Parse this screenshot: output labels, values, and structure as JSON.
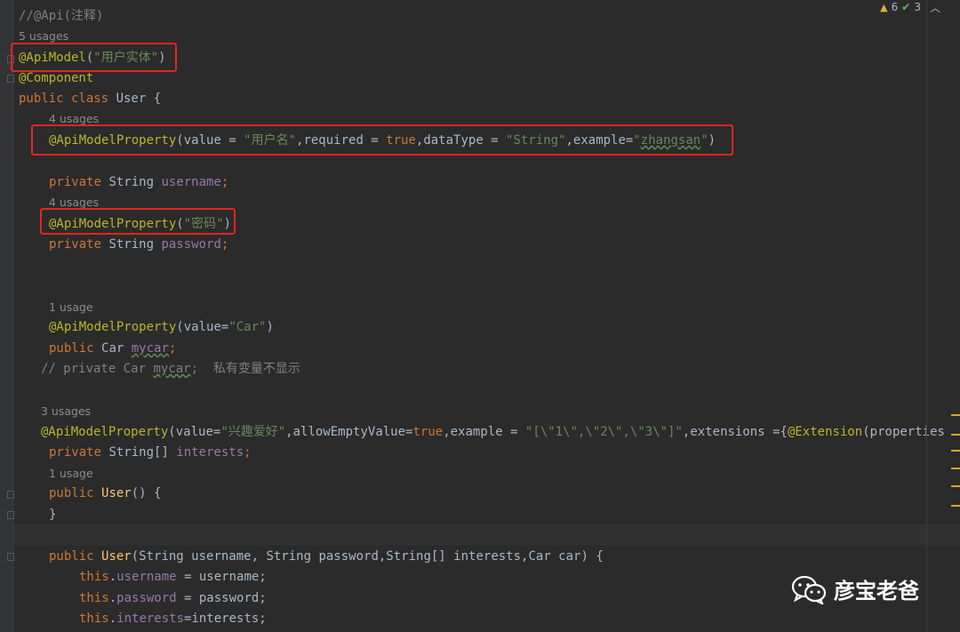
{
  "editor": {
    "inspections": {
      "warnings": "6",
      "weak_warnings": "3"
    },
    "lines": {
      "l1": "//@Api(注释)",
      "u1": "5 usages",
      "l2_ann": "@ApiModel",
      "l2_p1": "(",
      "l2_str": "\"用户实体\"",
      "l2_p2": ")",
      "l3": "@Component",
      "l4_kw": "public class ",
      "l4_rest": "User {",
      "u2": "4 usages",
      "l5_ann": "@ApiModelProperty",
      "l5_a": "(value = ",
      "l5_s1": "\"用户名\"",
      "l5_b": ",required = ",
      "l5_kw": "true",
      "l5_c": ",dataType = ",
      "l5_s2": "\"String\"",
      "l5_d": ",example=",
      "l5_s3a": "\"",
      "l5_s3b": "zhangsan",
      "l5_s3c": "\"",
      "l5_e": ")",
      "l6_kw": "private ",
      "l6_type": "String ",
      "l6_fld": "username",
      "l6_semi": ";",
      "u3": "4 usages",
      "l7_ann": "@ApiModelProperty",
      "l7_a": "(",
      "l7_str": "\"密码\"",
      "l7_b": ")",
      "l8_kw": "private ",
      "l8_type": "String ",
      "l8_fld": "password",
      "l8_semi": ";",
      "u4": "1 usage",
      "l9_ann": "@ApiModelProperty",
      "l9_a": "(value=",
      "l9_str": "\"Car\"",
      "l9_b": ")",
      "l10_kw": "public ",
      "l10_type": "Car ",
      "l10_fld": "mycar",
      "l10_semi": ";",
      "l11_a": "// private Car ",
      "l11_b": "mycar",
      "l11_c": ";  私有变量不显示",
      "u5": "3 usages",
      "l12_ann": "@ApiModelProperty",
      "l12_a": "(value=",
      "l12_s1": "\"兴趣爱好\"",
      "l12_b": ",allowEmptyValue=",
      "l12_kw": "true",
      "l12_c": ",example = ",
      "l12_s2": "\"[\\\"1\\\",\\\"2\\\",\\\"3\\\"]\"",
      "l12_d": ",extensions ={",
      "l12_ann2": "@Extension",
      "l12_e": "(properties",
      "l13_kw": "private ",
      "l13_type": "String[] ",
      "l13_fld": "interests",
      "l13_semi": ";",
      "u6": "1 usage",
      "l14_kw": "public ",
      "l14_fn": "User",
      "l14_rest": "() {",
      "l15": "}",
      "l16_kw": "public ",
      "l16_fn": "User",
      "l16_rest": "(String username, String password,String[] interests,Car car) {",
      "l17_kw": "this",
      "l17_dot": ".",
      "l17_fld": "username",
      "l17_rest": " = username;",
      "l18_kw": "this",
      "l18_dot": ".",
      "l18_fld": "password",
      "l18_rest": " = password;",
      "l19_kw": "this",
      "l19_dot": ".",
      "l19_fld": "interests",
      "l19_rest": "=interests;"
    }
  },
  "watermark": {
    "text": "彦宝老爸"
  },
  "colors": {
    "annotation": "#bbb529",
    "keyword": "#cc7832",
    "string": "#6a8759",
    "field": "#9876aa",
    "highlight": "#e1261c"
  }
}
